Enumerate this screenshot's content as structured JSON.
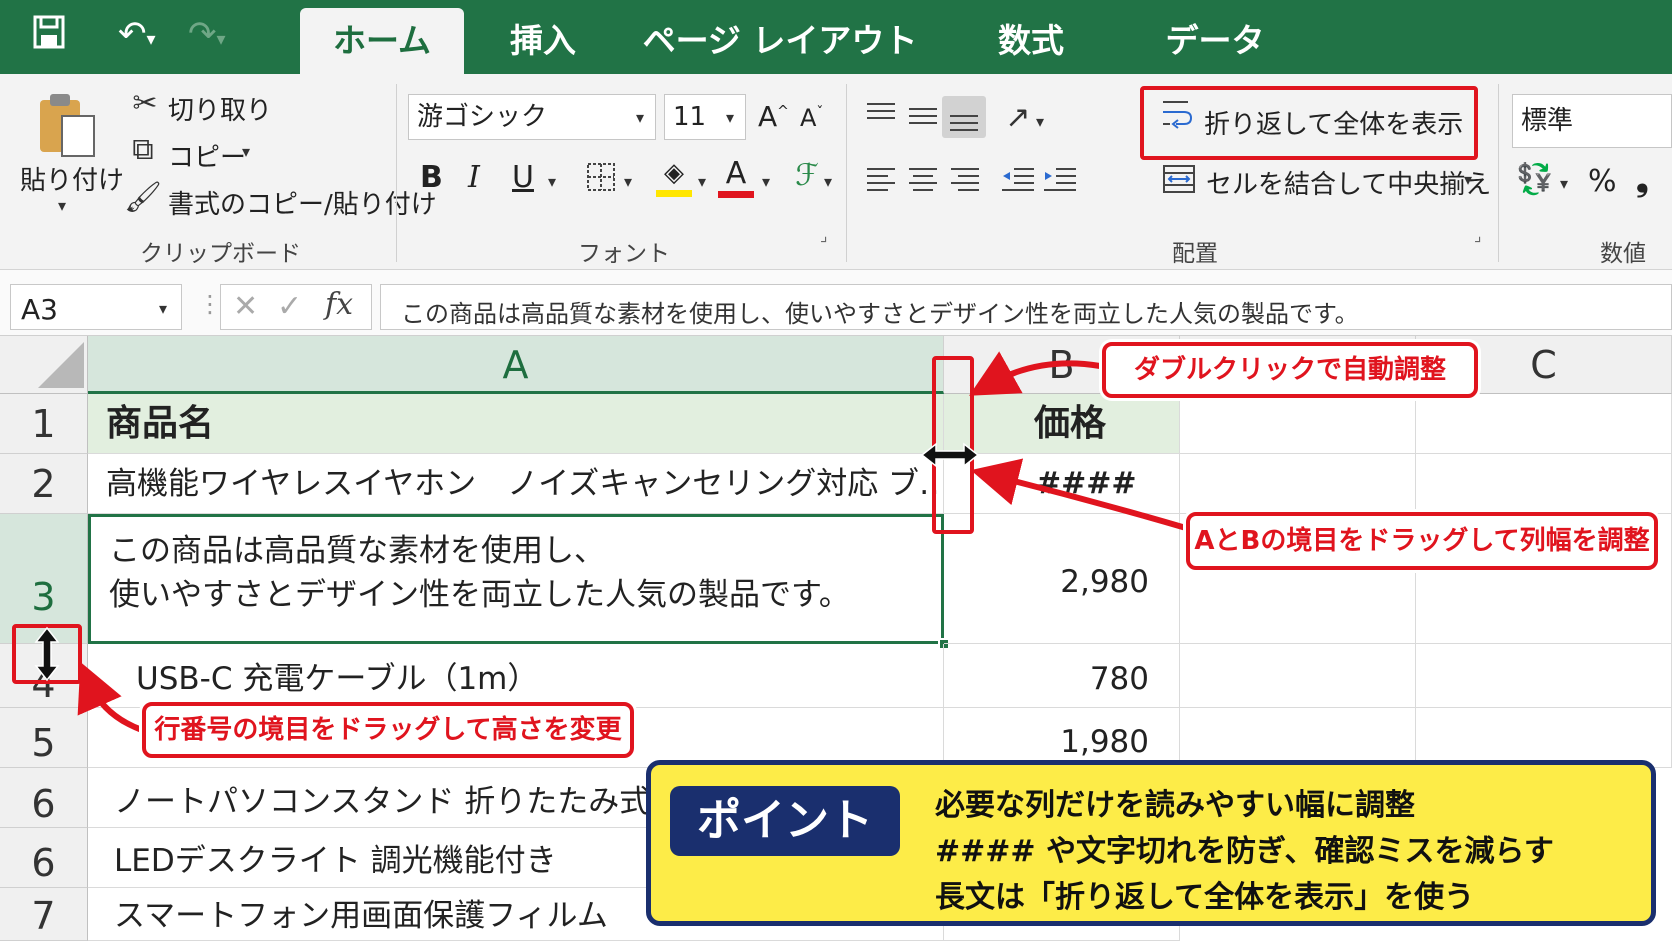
{
  "tabs": [
    {
      "label": "ホーム",
      "active": true
    },
    {
      "label": "挿入",
      "active": false
    },
    {
      "label": "ページ レイアウト",
      "active": false
    },
    {
      "label": "数式",
      "active": false
    },
    {
      "label": "データ",
      "active": false
    }
  ],
  "clipboard": {
    "paste": "貼り付け",
    "cut": "切り取り",
    "copy": "コピー",
    "format_painter": "書式のコピー/貼り付け",
    "group": "クリップボード"
  },
  "font": {
    "name": "游ゴシック",
    "size": "11",
    "grow": "A",
    "shrink": "A",
    "bold": "B",
    "italic": "I",
    "underline": "U",
    "fill_letter": "◈",
    "color_letter": "A",
    "group": "フォント"
  },
  "alignment": {
    "wrap_text": "折り返して全体を表示",
    "merge_center": "セルを結合して中央揃え",
    "group": "配置"
  },
  "number": {
    "format": "標準",
    "percent": "%",
    "comma": "❟",
    "group": "数値"
  },
  "formula_bar": {
    "name_box": "A3",
    "fx": "fx",
    "content": "この商品は高品質な素材を使用し、使いやすさとデザイン性を両立した人気の製品です。"
  },
  "columns": [
    "A",
    "B",
    "C"
  ],
  "rows": [
    {
      "num": "1",
      "a": "商品名",
      "b": "価格",
      "header": true
    },
    {
      "num": "2",
      "a": "高機能ワイヤレスイヤホン　ノイズキャンセリング対応 ブ…",
      "b": "####"
    },
    {
      "num": "3",
      "a_line1": "この商品は高品質な素材を使用し、",
      "a_line2": "使いやすさとデザイン性を両立した人気の製品です。",
      "b": "2,980"
    },
    {
      "num": "4",
      "a": "USB-C 充電ケーブル（1m）",
      "b": "780"
    },
    {
      "num": "5",
      "a": "",
      "b": "1,980"
    },
    {
      "num": "6",
      "a": "ノートパソコンスタンド 折りたたみ式",
      "b": ""
    },
    {
      "num": "6",
      "a": "LEDデスクライト 調光機能付き",
      "b": ""
    },
    {
      "num": "7",
      "a": "スマートフォン用画面保護フィルム",
      "b": ""
    }
  ],
  "annotations": {
    "double_click": "ダブルクリックで自動調整",
    "drag_column": "AとBの境目をドラッグして列幅を調整",
    "drag_row": "行番号の境目をドラッグして高さを変更"
  },
  "point": {
    "badge": "ポイント",
    "lines": [
      "必要な列だけを読みやすい幅に調整",
      "#### や文字切れを防ぎ、確認ミスを減らす",
      "長文は「折り返して全体を表示」を使う"
    ]
  },
  "colors": {
    "excel_green": "#217346",
    "annotation_red": "#e0141e",
    "point_yellow": "#fdec48",
    "point_navy": "#1a2f6e"
  }
}
